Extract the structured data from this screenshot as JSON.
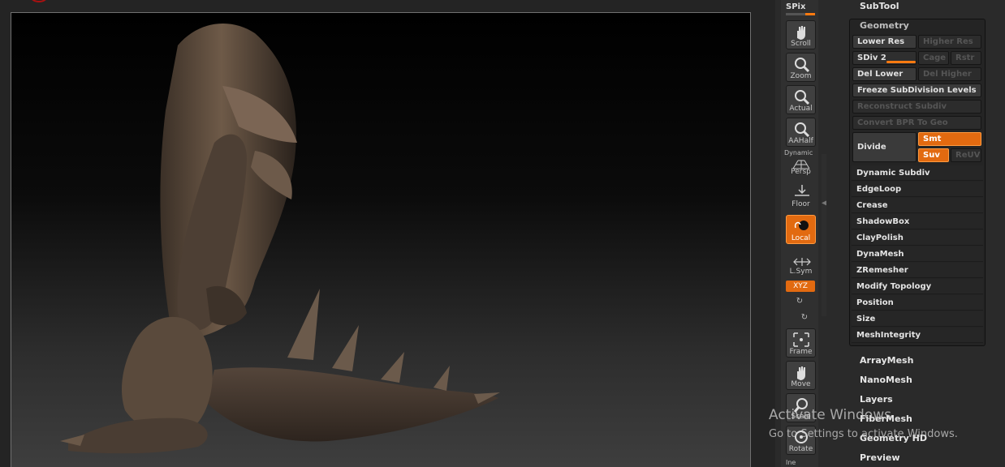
{
  "toolbar": {
    "spix_label": "SPix",
    "buttons": [
      {
        "id": "scroll",
        "label": "Scroll"
      },
      {
        "id": "zoom",
        "label": "Zoom"
      },
      {
        "id": "actual",
        "label": "Actual"
      },
      {
        "id": "aahalf",
        "label": "AAHalf"
      },
      {
        "id": "persp",
        "label": "Persp",
        "top_label": "Dynamic"
      },
      {
        "id": "floor",
        "label": "Floor"
      },
      {
        "id": "local",
        "label": "Local"
      },
      {
        "id": "lsym",
        "label": "L.Sym"
      },
      {
        "id": "frame",
        "label": "Frame"
      },
      {
        "id": "move",
        "label": "Move"
      },
      {
        "id": "scale",
        "label": "Scale"
      },
      {
        "id": "rotate",
        "label": "Rotate"
      }
    ],
    "xyz_label": "XYZ",
    "bottom_label": "Ine",
    "active_color": "#e26a10"
  },
  "palette": {
    "subtool_title": "SubTool",
    "geometry_title": "Geometry",
    "lower_res": "Lower Res",
    "higher_res": "Higher Res",
    "sdiv": "SDiv 2",
    "cage": "Cage",
    "rstr": "Rstr",
    "del_lower": "Del Lower",
    "del_higher": "Del Higher",
    "freeze": "Freeze SubDivision Levels",
    "reconstruct": "Reconstruct Subdiv",
    "convert_bpr": "Convert BPR To Geo",
    "divide": "Divide",
    "smt": "Smt",
    "suv": "Suv",
    "reuv": "ReUV",
    "sub_items": [
      "Dynamic Subdiv",
      "EdgeLoop",
      "Crease",
      "ShadowBox",
      "ClayPolish",
      "DynaMesh",
      "ZRemesher",
      "Modify Topology",
      "Position",
      "Size",
      "MeshIntegrity"
    ],
    "sections": [
      "ArrayMesh",
      "NanoMesh",
      "Layers",
      "FiberMesh",
      "Geometry HD",
      "Preview"
    ]
  },
  "watermark": {
    "title": "Activate Windows",
    "subtitle": "Go to Settings to activate Windows."
  },
  "colors": {
    "accent": "#e26a10",
    "model": "#5e4c3d"
  }
}
